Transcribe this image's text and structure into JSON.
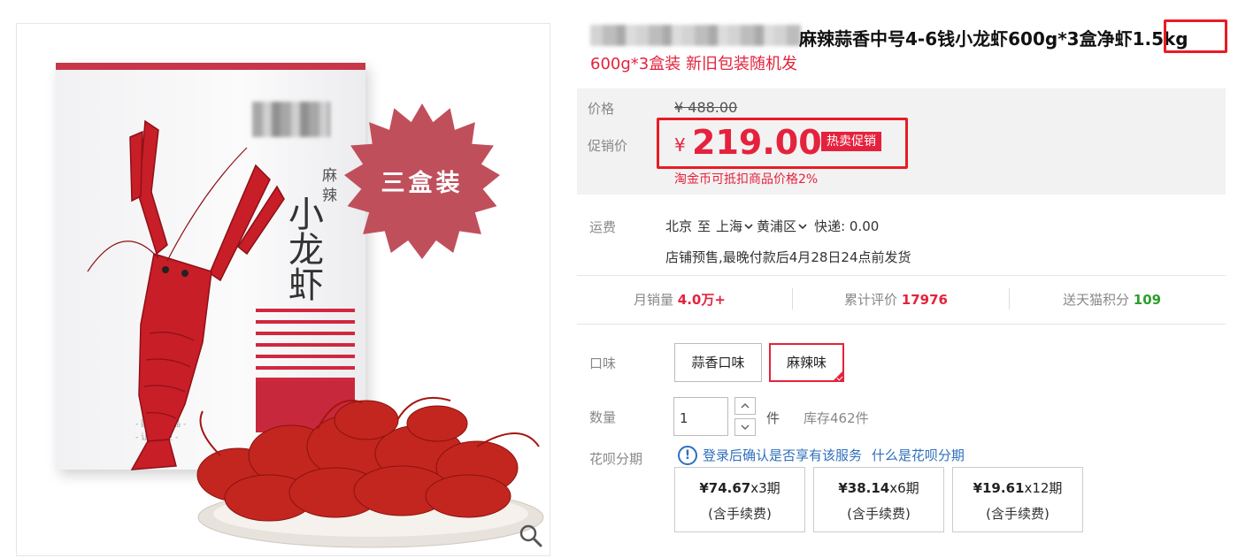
{
  "product": {
    "title": "麻辣蒜香中号4-6钱小龙虾600g*3盒净虾1.5kg",
    "title_main": "麻辣蒜香中号4-6钱小龙虾600g*3盒净虾",
    "title_weight": "1.5kg",
    "subtitle": "600g*3盒装 新旧包装随机发"
  },
  "image": {
    "box_brand": "麻 辣",
    "box_title": "小龙虾",
    "box_small_1": "- 国美食尚品 -",
    "box_small_2": "- 让生活更 -",
    "starburst": "三盒装"
  },
  "price": {
    "label": "价格",
    "original": "¥ 488.00",
    "promo_label": "促销价",
    "currency": "¥",
    "promo": "219.00",
    "promo_tag": "热卖促销",
    "coin_note": "淘金币可抵扣商品价格2%"
  },
  "shipping": {
    "label": "运费",
    "from": "北京",
    "to_word": "至",
    "city": "上海",
    "district": "黄浦区",
    "express": "快递: 0.00",
    "presale": "店铺预售,最晚付款后4月28日24点前发货"
  },
  "stats": {
    "monthly_label": "月销量",
    "monthly_value": "4.0万+",
    "reviews_label": "累计评价",
    "reviews_value": "17976",
    "points_label": "送天猫积分",
    "points_value": "109"
  },
  "flavor": {
    "label": "口味",
    "options": [
      "蒜香口味",
      "麻辣味"
    ],
    "selected_index": 1
  },
  "quantity": {
    "label": "数量",
    "value": "1",
    "unit": "件",
    "stock": "库存462件"
  },
  "huabei": {
    "label": "花呗分期",
    "login_link": "登录",
    "note": "后确认是否享有该服务",
    "what_link": "什么是花呗分期",
    "plans": [
      {
        "amount": "¥74.67",
        "periods": "x3期",
        "fee": "(含手续费)"
      },
      {
        "amount": "¥38.14",
        "periods": "x6期",
        "fee": "(含手续费)"
      },
      {
        "amount": "¥19.61",
        "periods": "x12期",
        "fee": "(含手续费)"
      }
    ]
  },
  "colors": {
    "accent_red": "#e5223d",
    "highlight_red": "#e81b23",
    "link_blue": "#2f6fbd",
    "points_green": "#2e9e2e"
  },
  "icons": [
    "zoom-icon",
    "chevron-down-icon",
    "info-icon",
    "checkmark-icon"
  ]
}
